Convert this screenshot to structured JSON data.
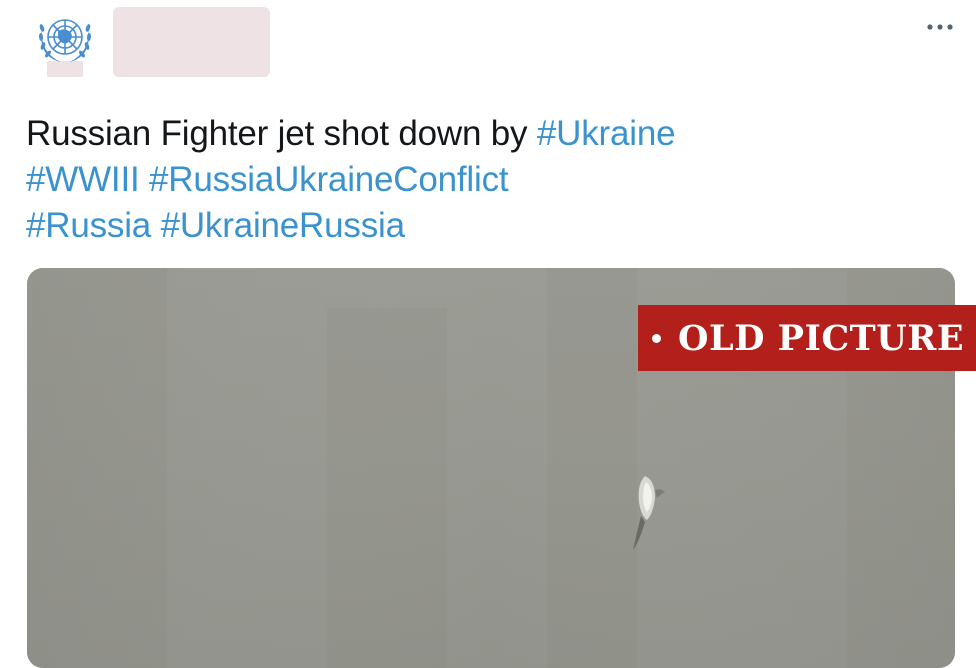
{
  "tweet": {
    "author": {
      "avatar_icon": "un-emblem-icon",
      "avatar_color": "#4a8ed0",
      "name_redacted_color": "#efe2e5"
    },
    "more_icon": "more-options-icon",
    "text": {
      "plain": "Russian Fighter jet shot down by ",
      "hashtags": [
        "#Ukraine",
        "#WWIII",
        "#RussiaUkraineConflict",
        "#Russia",
        "#UkraineRussia"
      ]
    },
    "hashtag_color": "#3a92cf",
    "media": {
      "description_icon": "falling-jet-icon",
      "background_color": "#9a9b93"
    }
  },
  "overlay_badge": {
    "label": "OLD PICTURE",
    "color": "#b3201b"
  }
}
